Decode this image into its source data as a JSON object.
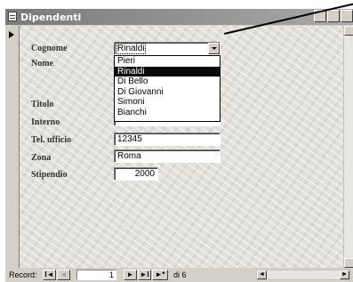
{
  "window": {
    "title": "Dipendenti"
  },
  "labels": {
    "cognome": "Cognome",
    "nome": "Nome",
    "titolo": "Titolo",
    "interno": "Interno",
    "tel_ufficio": "Tel. ufficio",
    "zona": "Zona",
    "stipendio": "Stipendio"
  },
  "fields": {
    "cognome": "Rinaldi",
    "tel_ufficio": "12345",
    "zona": "Roma",
    "stipendio": "2000"
  },
  "dropdown": {
    "options": [
      "Pieri",
      "Rinaldi",
      "Di Bello",
      "Di Giovanni",
      "Simoni",
      "Bianchi"
    ],
    "selected_index": 1
  },
  "navigation": {
    "record_label": "Record:",
    "current_record": "1",
    "of_total": "di 6",
    "first_glyph": "I◄",
    "prev_glyph": "◄",
    "next_glyph": "►",
    "last_glyph": "►I",
    "new_glyph": "►*"
  },
  "icons": [
    "form-icon",
    "minimize-icon",
    "maximize-icon",
    "close-icon",
    "record-selector-icon",
    "combo-arrow-icon"
  ],
  "colors": {
    "selection_bg": "#0a0a0a",
    "titlebar": "#7a7a7a",
    "chrome": "#d4d0c8"
  }
}
